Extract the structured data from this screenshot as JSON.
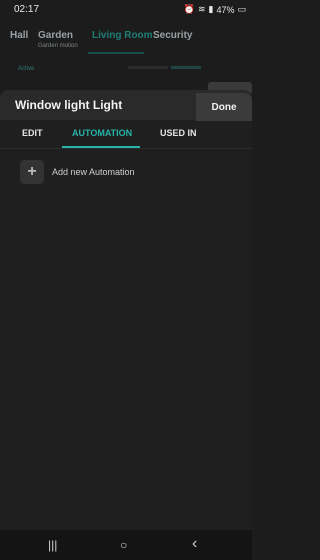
{
  "status": {
    "time": "02:17",
    "battery": "47%",
    "icons": [
      "alarm-icon",
      "wifi-icon",
      "volte-icon",
      "signal-icon",
      "battery-icon"
    ]
  },
  "background_tabs": [
    {
      "label": "Hall",
      "sub": ""
    },
    {
      "label": "Garden",
      "sub": "Garden motion"
    },
    {
      "label": "Living Room",
      "sub": ""
    },
    {
      "label": "Security",
      "sub": ""
    }
  ],
  "background": {
    "hint": "Active"
  },
  "sheet": {
    "title": "Window light Light",
    "done_label": "Done",
    "tabs": [
      {
        "label": "EDIT"
      },
      {
        "label": "AUTOMATION"
      },
      {
        "label": "USED IN"
      }
    ],
    "active_tab": 1,
    "add_label": "Add new Automation"
  },
  "nav": {
    "recent_symbol": "|||",
    "home_symbol": "○",
    "back_symbol": "‹"
  },
  "colors": {
    "accent": "#27b3a8",
    "background": "#1c1c1c",
    "sheet": "#1f1f1f"
  }
}
